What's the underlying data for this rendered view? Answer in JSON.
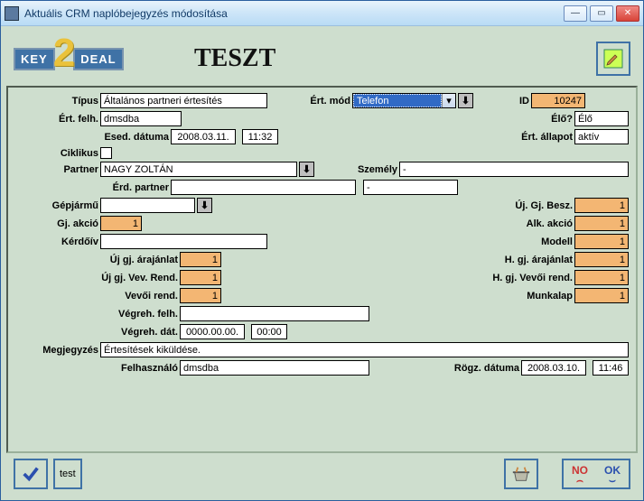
{
  "window": {
    "title": "Aktuális CRM naplóbejegyzés módosítása"
  },
  "header": {
    "teszt": "TESZT",
    "logo_key": "KEY",
    "logo_two": "2",
    "logo_deal": "DEAL"
  },
  "fields": {
    "tipus_label": "Típus",
    "tipus_value": "Általános partneri értesítés",
    "ert_mod_label": "Ért. mód",
    "ert_mod_value": "Telefon",
    "id_label": "ID",
    "id_value": "10247",
    "ert_felh_label": "Ért. felh.",
    "ert_felh_value": "dmsdba",
    "elo_label": "Élő?",
    "elo_value": "Élő",
    "esed_datuma_label": "Esed. dátuma",
    "esed_date": "2008.03.11.",
    "esed_time": "11:32",
    "ert_allapot_label": "Ért. állapot",
    "ert_allapot_value": "aktív",
    "ciklikus_label": "Ciklikus",
    "partner_label": "Partner",
    "partner_value": "NAGY   ZOLTÁN",
    "szemely_label": "Személy",
    "szemely_value": "-",
    "erd_partner_label": "Érd. partner",
    "erd_partner_value": "",
    "erd_partner_2": "-",
    "gepjarmu_label": "Gépjármű",
    "gepjarmu_value": "",
    "uj_gj_besz_label": "Új. Gj. Besz.",
    "uj_gj_besz_value": "1",
    "gj_akcio_label": "Gj. akció",
    "gj_akcio_value": "1",
    "alk_akcio_label": "Alk. akció",
    "alk_akcio_value": "1",
    "kerdoiv_label": "Kérdőív",
    "kerdoiv_value": "",
    "modell_label": "Modell",
    "modell_value": "1",
    "uj_gj_arajanlat_label": "Új gj. árajánlat",
    "uj_gj_arajanlat_value": "1",
    "h_gj_arajanlat_label": "H. gj. árajánlat",
    "h_gj_arajanlat_value": "1",
    "uj_gj_vev_rend_label": "Új gj. Vev. Rend.",
    "uj_gj_vev_rend_value": "1",
    "h_gj_vevoi_rend_label": "H. gj. Vevői rend.",
    "h_gj_vevoi_rend_value": "1",
    "vevoi_rend_label": "Vevői rend.",
    "vevoi_rend_value": "1",
    "munkalap_label": "Munkalap",
    "munkalap_value": "1",
    "vegreh_felh_label": "Végreh. felh.",
    "vegreh_felh_value": "",
    "vegreh_dat_label": "Végreh. dát.",
    "vegreh_date": "0000.00.00.",
    "vegreh_time": "00:00",
    "megjegyzes_label": "Megjegyzés",
    "megjegyzes_value": "Értesítések kiküldése.",
    "felhasznalo_label": "Felhasználó",
    "felhasznalo_value": "dmsdba",
    "rogz_datuma_label": "Rögz. dátuma",
    "rogz_date": "2008.03.10.",
    "rogz_time": "11:46"
  },
  "actions": {
    "test": "test",
    "no": "NO",
    "ok": "OK"
  }
}
